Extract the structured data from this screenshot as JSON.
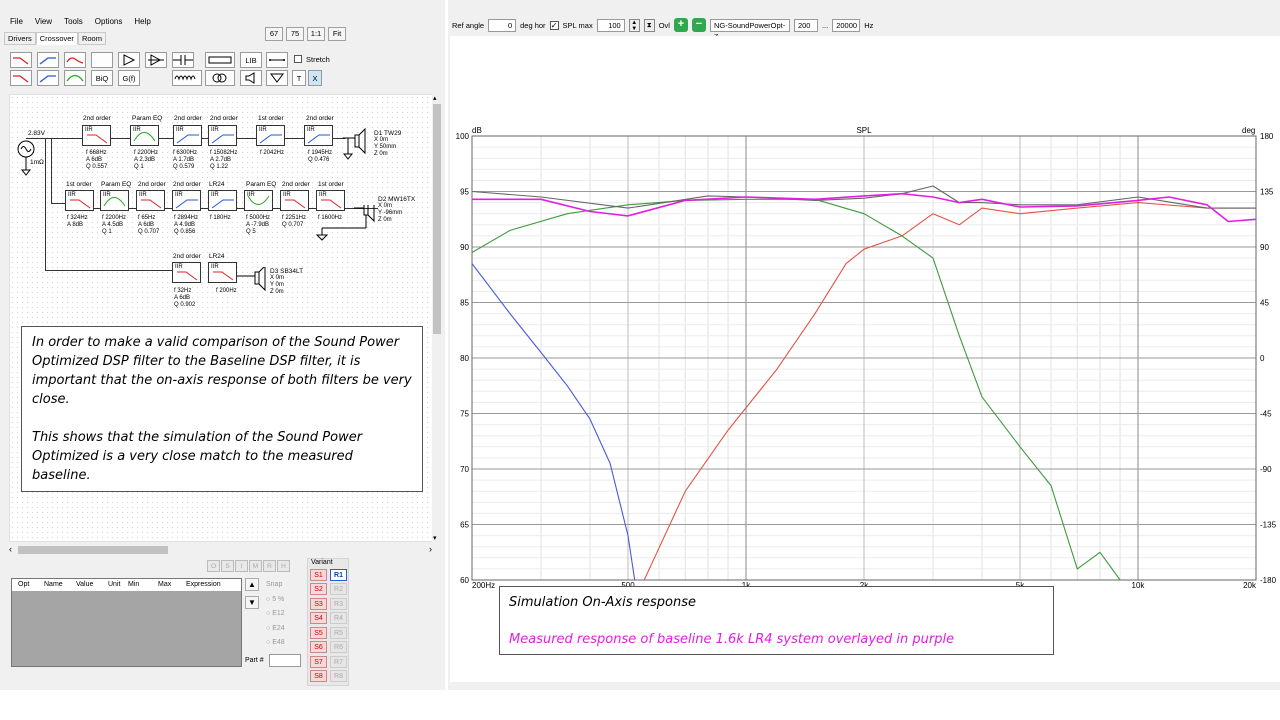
{
  "menu": [
    "File",
    "View",
    "Tools",
    "Options",
    "Help"
  ],
  "tabs": [
    "Drivers",
    "Crossover",
    "Room"
  ],
  "zoom_buttons": [
    "67",
    "75",
    "1:1",
    "Fit"
  ],
  "toolbar": {
    "biq": "BiQ",
    "gf": "G(f)",
    "lib": "LIB",
    "t": "T",
    "x": "X",
    "stretch": "Stretch"
  },
  "schematic": {
    "voltage": "2.83V",
    "source_r": "1mΩ",
    "iir": "IIR",
    "row1": [
      {
        "label": "2nd order",
        "params": [
          "f  668Hz",
          "A  6dB",
          "Q  0.557"
        ]
      },
      {
        "label": "Param EQ",
        "params": [
          "f  2200Hz",
          "A  2.3dB",
          "Q  1"
        ]
      },
      {
        "label": "2nd order",
        "params": [
          "f  6300Hz",
          "A  1.7dB",
          "Q  0.579"
        ]
      },
      {
        "label": "2nd order",
        "params": [
          "f  15082Hz",
          "A  2.7dB",
          "Q  1.22"
        ]
      },
      {
        "label": "1st order",
        "params": [
          "f  2042Hz"
        ]
      },
      {
        "label": "2nd order",
        "params": [
          "f  1945Hz",
          "Q  0.476"
        ]
      }
    ],
    "row2": [
      {
        "label": "1st order",
        "params": [
          "f  324Hz",
          "A  8dB"
        ]
      },
      {
        "label": "Param EQ",
        "params": [
          "f  2200Hz",
          "A  4.5dB",
          "Q  1"
        ]
      },
      {
        "label": "2nd order",
        "params": [
          "f  65Hz",
          "A  6dB",
          "Q  0.707"
        ]
      },
      {
        "label": "2nd order",
        "params": [
          "f  2894Hz",
          "A  4.9dB",
          "Q  0.856"
        ]
      },
      {
        "label": "LR24",
        "params": [
          "f  180Hz"
        ]
      },
      {
        "label": "Param EQ",
        "params": [
          "f  5000Hz",
          "A  -7.9dB",
          "Q  5"
        ]
      },
      {
        "label": "2nd order",
        "params": [
          "f  2251Hz",
          "Q  0.707"
        ]
      },
      {
        "label": "1st order",
        "params": [
          "f  1600Hz"
        ]
      }
    ],
    "row3": [
      {
        "label": "2nd order",
        "params": [
          "f  32Hz",
          "A  6dB",
          "Q  0.902"
        ]
      },
      {
        "label": "LR24",
        "params": [
          "f  200Hz"
        ]
      }
    ],
    "drivers": [
      {
        "name": "D1 TW29",
        "lines": [
          "X 0m",
          "Y 50mm",
          "Z 0m"
        ]
      },
      {
        "name": "D2 MW16TX",
        "lines": [
          "X 0m",
          "Y -96mm",
          "Z 0m"
        ]
      },
      {
        "name": "D3 SB34LT",
        "lines": [
          "X 0m",
          "Y 0m",
          "Z 0m"
        ]
      }
    ]
  },
  "note": {
    "p1": "In order to make a valid comparison of the Sound Power Optimized DSP filter to the Baseline DSP filter, it is important that the on-axis response of both filters be very close.",
    "p2": "This shows that the simulation of the Sound Power Optimized is a very close match to the measured baseline."
  },
  "optimizer": {
    "buttons": [
      "O",
      "S",
      "I",
      "M",
      "R",
      "H"
    ],
    "columns": [
      "Opt",
      "Name",
      "Value",
      "Unit",
      "Min",
      "Max",
      "Expression"
    ],
    "snap_label": "Snap",
    "snap_options": [
      "5 %",
      "E12",
      "E24",
      "E48"
    ],
    "part_label": "Part #"
  },
  "variant": {
    "label": "Variant",
    "s": [
      "S1",
      "S2",
      "S3",
      "S4",
      "S5",
      "S6",
      "S7",
      "S8"
    ],
    "r": [
      "R1",
      "R2",
      "R3",
      "R4",
      "R5",
      "R6",
      "R7",
      "R8"
    ]
  },
  "graph_toolbar": {
    "ref_angle_label": "Ref angle",
    "ref_angle_value": "0",
    "deg_hor": "deg hor",
    "spl_max_label": "SPL max",
    "spl_max_value": "100",
    "ovl": "Ovl",
    "curve_name": "NG-SoundPowerOpt-7",
    "f_min": "200",
    "dots": "...",
    "f_max": "20000",
    "hz": "Hz"
  },
  "chart_data": {
    "type": "line",
    "title": "SPL",
    "ylabel": "dB",
    "y2label": "deg",
    "xlim": [
      200,
      20000
    ],
    "xscale": "log",
    "ylim": [
      60,
      100
    ],
    "y2lim": [
      -180,
      180
    ],
    "x_ticks": [
      "200Hz",
      "500",
      "1k",
      "2k",
      "5k",
      "10k",
      "20k"
    ],
    "y_ticks": [
      "60",
      "65",
      "70",
      "75",
      "80",
      "85",
      "90",
      "95",
      "100"
    ],
    "y2_ticks": [
      "-180",
      "-135",
      "-90",
      "-45",
      "0",
      "45",
      "90",
      "135",
      "180"
    ],
    "grid": true,
    "series": [
      {
        "color": "#4a5ad8",
        "x": [
          200,
          250,
          300,
          350,
          400,
          450,
          500,
          520
        ],
        "y": [
          88.5,
          84,
          80.5,
          77.5,
          74.5,
          70.5,
          64,
          60
        ]
      },
      {
        "color": "#e05545",
        "x": [
          550,
          700,
          900,
          1200,
          1500,
          1800,
          2000,
          2500,
          3000,
          3500,
          4000,
          5000,
          7000,
          10000,
          15000,
          20000
        ],
        "y": [
          60,
          68,
          73.5,
          79,
          84,
          88.5,
          89.8,
          91,
          93,
          92,
          93.5,
          93,
          93.5,
          94,
          93.5,
          93.5
        ]
      },
      {
        "color": "#3e9a3e",
        "x": [
          200,
          250,
          350,
          500,
          700,
          1000,
          1500,
          2000,
          2500,
          3000,
          3500,
          4000,
          5000,
          6000,
          7000,
          8000,
          9000
        ],
        "y": [
          89.5,
          91.5,
          93,
          93.8,
          94.2,
          94.3,
          94.3,
          93,
          91,
          89,
          82,
          76.5,
          72,
          68.5,
          61,
          62.5,
          60
        ]
      },
      {
        "color": "#666666",
        "x": [
          200,
          300,
          500,
          800,
          1000,
          1500,
          2000,
          2500,
          3000,
          3500,
          4000,
          5000,
          7000,
          10000,
          15000,
          20000
        ],
        "y": [
          95,
          94.5,
          93.5,
          94.6,
          94.5,
          94.2,
          94.4,
          94.8,
          95.5,
          94,
          94,
          93.8,
          93.8,
          94.5,
          93.5,
          93.5
        ]
      },
      {
        "color": "#e020e0",
        "x": [
          200,
          300,
          400,
          500,
          700,
          1000,
          1500,
          2000,
          2500,
          3000,
          3500,
          4000,
          5000,
          7000,
          10000,
          12000,
          15000,
          17000,
          20000
        ],
        "y": [
          94.3,
          94.3,
          93.2,
          92.8,
          94.2,
          94.5,
          94.3,
          94.6,
          94.8,
          94.5,
          94,
          94.3,
          93.6,
          93.7,
          94.2,
          94.5,
          93.8,
          92.3,
          92.5
        ]
      }
    ]
  },
  "chart_legend": {
    "line1": "Simulation On-Axis response",
    "line2": "Measured response of baseline 1.6k LR4 system overlayed in purple",
    "line2_color": "#e020e0"
  }
}
